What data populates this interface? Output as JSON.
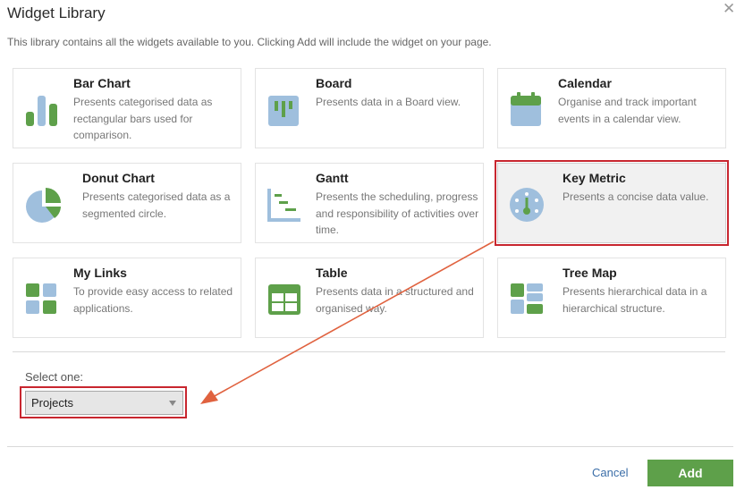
{
  "dialog": {
    "title": "Widget Library",
    "description": "This library contains all the widgets available to you. Clicking Add will include the widget on your page."
  },
  "widgets": [
    {
      "name": "Bar Chart",
      "desc": "Presents categorised data as rectangular bars used for comparison.",
      "icon": "bar-chart-icon",
      "selected": false
    },
    {
      "name": "Board",
      "desc": "Presents data in a Board view.",
      "icon": "board-icon",
      "selected": false
    },
    {
      "name": "Calendar",
      "desc": "Organise and track important events in a calendar view.",
      "icon": "calendar-icon",
      "selected": false
    },
    {
      "name": "Donut Chart",
      "desc": "Presents categorised data as a segmented circle.",
      "icon": "donut-chart-icon",
      "selected": false
    },
    {
      "name": "Gantt",
      "desc": "Presents the scheduling, progress and responsibility of activities over time.",
      "icon": "gantt-icon",
      "selected": false
    },
    {
      "name": "Key Metric",
      "desc": "Presents a concise data value.",
      "icon": "gauge-icon",
      "selected": true
    },
    {
      "name": "My Links",
      "desc": "To provide easy access to related applications.",
      "icon": "links-grid-icon",
      "selected": false
    },
    {
      "name": "Table",
      "desc": "Presents data in a structured and organised way.",
      "icon": "table-icon",
      "selected": false
    },
    {
      "name": "Tree Map",
      "desc": "Presents hierarchical data in a hierarchical structure.",
      "icon": "tree-map-icon",
      "selected": false
    }
  ],
  "selector": {
    "label": "Select one:",
    "value": "Projects"
  },
  "footer": {
    "cancel": "Cancel",
    "add": "Add"
  },
  "colors": {
    "green": "#5ea04a",
    "blue": "#9fbfdd",
    "highlight": "#c8262f",
    "link": "#3b6ea8"
  }
}
